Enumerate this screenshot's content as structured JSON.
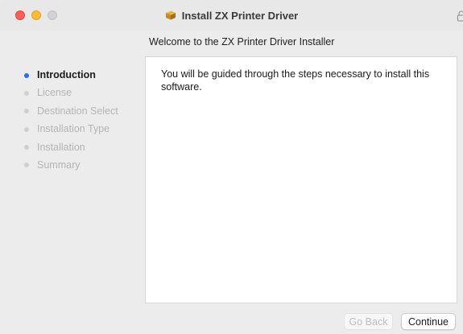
{
  "window": {
    "title": "Install ZX Printer Driver",
    "icon": "package-icon",
    "lock_icon": "lock-icon"
  },
  "main": {
    "heading": "Welcome to the ZX Printer Driver Installer",
    "body": "You will be guided through the steps necessary to install this software."
  },
  "sidebar": {
    "steps": [
      {
        "label": "Introduction",
        "active": true
      },
      {
        "label": "License",
        "active": false
      },
      {
        "label": "Destination Select",
        "active": false
      },
      {
        "label": "Installation Type",
        "active": false
      },
      {
        "label": "Installation",
        "active": false
      },
      {
        "label": "Summary",
        "active": false
      }
    ]
  },
  "buttons": {
    "go_back": "Go Back",
    "continue": "Continue"
  },
  "colors": {
    "active_step_dot": "#1f6ff0",
    "close": "#fe5f57",
    "minimize": "#febc2e",
    "zoom_inactive": "#d2d2d2"
  }
}
